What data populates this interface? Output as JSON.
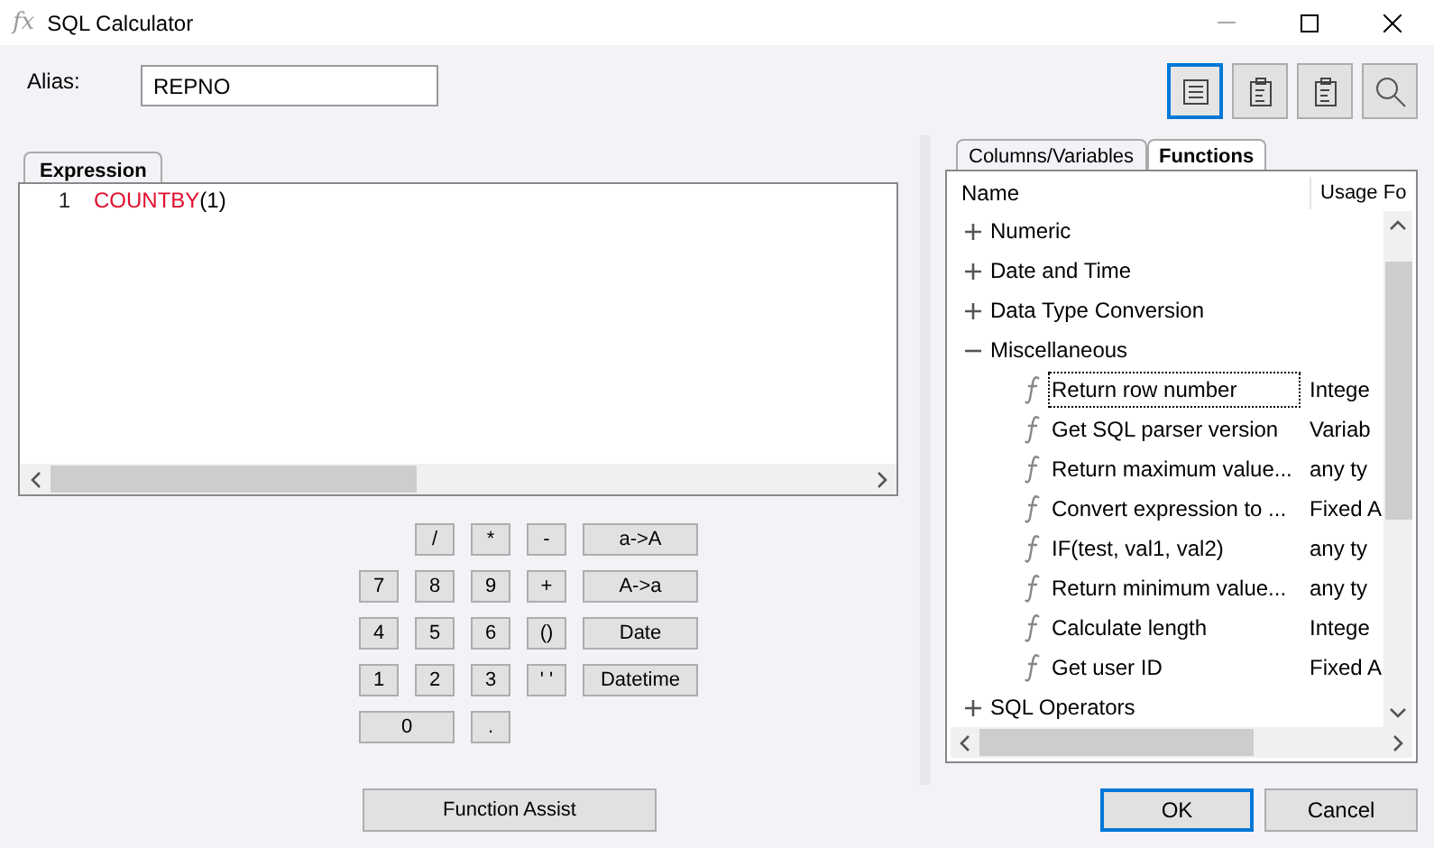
{
  "window": {
    "icon": "fx",
    "title": "SQL Calculator"
  },
  "alias": {
    "label": "Alias:",
    "value": "REPNO"
  },
  "expression": {
    "tab": "Expression",
    "lines": [
      {
        "number": "1",
        "func": "COUNTBY",
        "args": "(1)"
      }
    ]
  },
  "keypad": [
    [
      {
        "label": "/",
        "kind": "key"
      },
      {
        "label": "*",
        "kind": "key"
      },
      {
        "label": "-",
        "kind": "key"
      },
      {
        "label": "a->A",
        "kind": "wide"
      }
    ],
    [
      {
        "label": "7",
        "kind": "key"
      },
      {
        "label": "8",
        "kind": "key"
      },
      {
        "label": "9",
        "kind": "key"
      },
      {
        "label": "+",
        "kind": "key"
      },
      {
        "label": "A->a",
        "kind": "wide"
      }
    ],
    [
      {
        "label": "4",
        "kind": "key"
      },
      {
        "label": "5",
        "kind": "key"
      },
      {
        "label": "6",
        "kind": "key"
      },
      {
        "label": "()",
        "kind": "key"
      },
      {
        "label": "Date",
        "kind": "wide"
      }
    ],
    [
      {
        "label": "1",
        "kind": "key"
      },
      {
        "label": "2",
        "kind": "key"
      },
      {
        "label": "3",
        "kind": "key"
      },
      {
        "label": "' '",
        "kind": "key"
      },
      {
        "label": "Datetime",
        "kind": "wide"
      }
    ],
    [
      {
        "label": "0",
        "kind": "double"
      },
      {
        "label": ".",
        "kind": "key"
      }
    ]
  ],
  "function_assist": "Function Assist",
  "toolbar": [
    {
      "kind": "list",
      "selected": true
    },
    {
      "kind": "clipboard",
      "selected": false
    },
    {
      "kind": "clipboard",
      "selected": false
    },
    {
      "kind": "search",
      "selected": false
    }
  ],
  "tabs": [
    {
      "label": "Columns/Variables",
      "selected": false
    },
    {
      "label": "Functions",
      "selected": true
    }
  ],
  "tree": {
    "columns": [
      "Name",
      "Usage Fo"
    ],
    "items": [
      {
        "name": "Numeric",
        "expanded": false
      },
      {
        "name": "Date and Time",
        "expanded": false
      },
      {
        "name": "Data Type Conversion",
        "expanded": false
      },
      {
        "name": "Miscellaneous",
        "expanded": true,
        "children": [
          {
            "name": "Return row number",
            "usage": "Intege",
            "selected": true
          },
          {
            "name": "Get SQL parser version",
            "usage": "Variab",
            "selected": false
          },
          {
            "name": "Return maximum value...",
            "usage": "any ty",
            "selected": false
          },
          {
            "name": "Convert expression to ...",
            "usage": "Fixed A",
            "selected": false
          },
          {
            "name": "IF(test, val1, val2)",
            "usage": "any ty",
            "selected": false
          },
          {
            "name": "Return minimum value...",
            "usage": "any ty",
            "selected": false
          },
          {
            "name": "Calculate length",
            "usage": "Intege",
            "selected": false
          },
          {
            "name": "Get user ID",
            "usage": "Fixed A",
            "selected": false
          }
        ]
      },
      {
        "name": "SQL Operators",
        "expanded": false
      }
    ]
  },
  "buttons": [
    {
      "label": "OK",
      "selected": true
    },
    {
      "label": "Cancel",
      "selected": false
    }
  ]
}
